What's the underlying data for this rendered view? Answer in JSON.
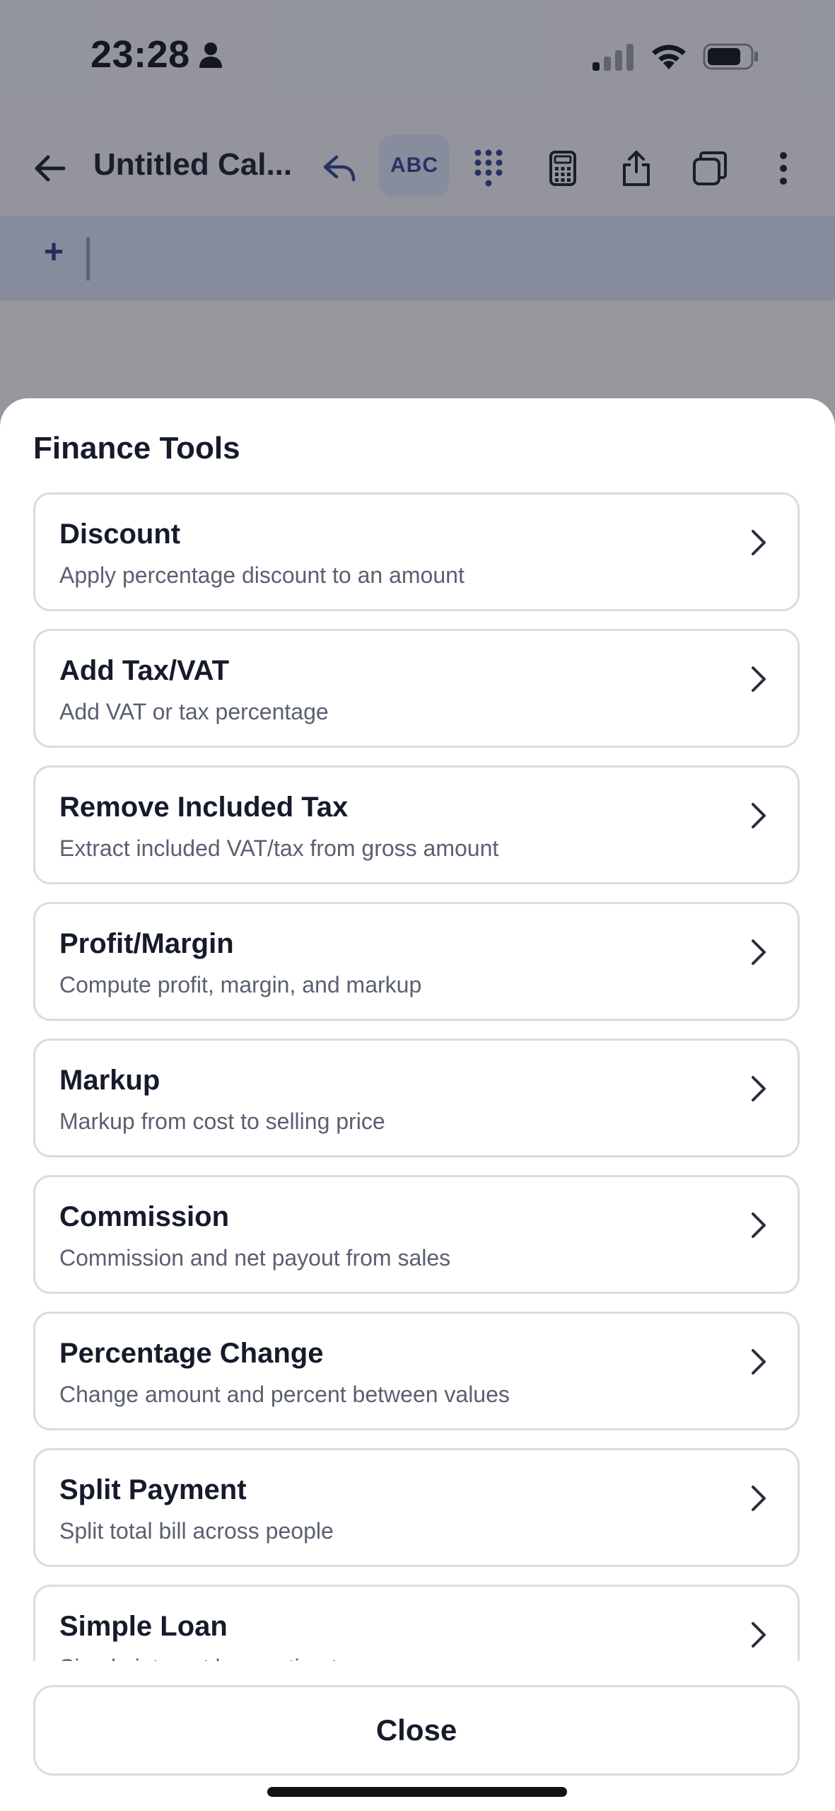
{
  "status_bar": {
    "time": "23:28",
    "icons": [
      "user-icon",
      "cellular-signal-icon",
      "wifi-icon",
      "battery-icon"
    ]
  },
  "app_bar": {
    "title": "Untitled Cal...",
    "abc_label": "ABC",
    "icons": [
      "back-arrow-icon",
      "undo-icon",
      "keypad-icon",
      "calculator-icon",
      "share-icon",
      "copy-icon",
      "more-vertical-icon"
    ]
  },
  "input": {
    "plus_symbol": "+"
  },
  "sheet": {
    "title": "Finance Tools",
    "tools": [
      {
        "name": "Discount",
        "description": "Apply percentage discount to an amount"
      },
      {
        "name": "Add Tax/VAT",
        "description": "Add VAT or tax percentage"
      },
      {
        "name": "Remove Included Tax",
        "description": "Extract included VAT/tax from gross amount"
      },
      {
        "name": "Profit/Margin",
        "description": "Compute profit, margin, and markup"
      },
      {
        "name": "Markup",
        "description": "Markup from cost to selling price"
      },
      {
        "name": "Commission",
        "description": "Commission and net payout from sales"
      },
      {
        "name": "Percentage Change",
        "description": "Change amount and percent between values"
      },
      {
        "name": "Split Payment",
        "description": "Split total bill across people"
      },
      {
        "name": "Simple Loan",
        "description": "Simple interest loan estimate"
      }
    ],
    "close_label": "Close"
  },
  "colors": {
    "accent": "#25368a",
    "accent_bg": "#dfe6fb",
    "overlay": "#1e212d",
    "card_border": "#d8dce4",
    "text_primary": "#161b2b",
    "text_secondary": "#5a6070"
  }
}
